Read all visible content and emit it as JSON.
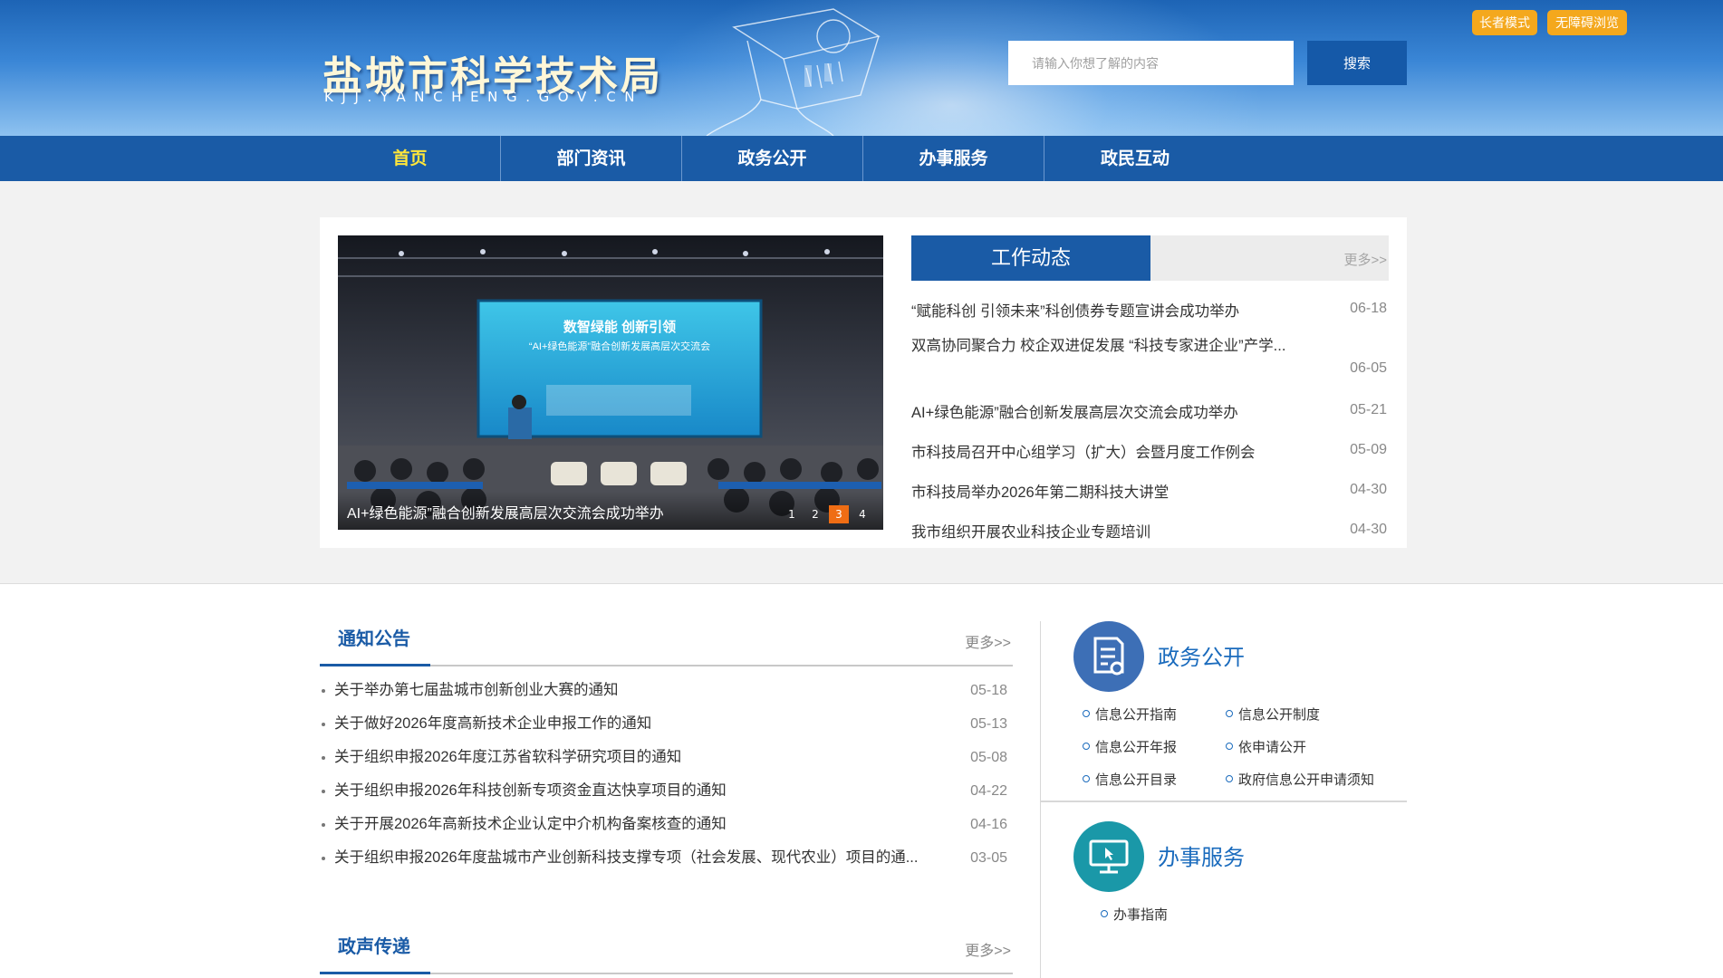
{
  "header": {
    "site_title": "盐城市科学技术局",
    "site_domain": "KJJ.YANCHENG.GOV.CN",
    "search_placeholder": "请输入你想了解的内容",
    "search_button": "搜索",
    "elder_mode": "长者模式",
    "barrier_free": "无障碍浏览"
  },
  "nav": {
    "items": [
      "首页",
      "部门资讯",
      "政务公开",
      "办事服务",
      "政民互动"
    ],
    "active_index": 0
  },
  "slider": {
    "caption": "AI+绿色能源”融合创新发展高层次交流会成功举办",
    "pages": [
      "1",
      "2",
      "3",
      "4"
    ],
    "active_page": 2,
    "screen_text_line1": "数智绿能 创新引领",
    "screen_text_line2": "“AI+绿色能源”融合创新发展高层次交流会"
  },
  "work_news": {
    "title": "工作动态",
    "more": "更多>>",
    "items": [
      {
        "title": "“赋能科创 引领未来”科创债券专题宣讲会成功举办",
        "date": "06-18"
      },
      {
        "title": "双高协同聚合力 校企双进促发展 “科技专家进企业”产学...",
        "date": "06-05"
      },
      {
        "title": "AI+绿色能源”融合创新发展高层次交流会成功举办",
        "date": "05-21"
      },
      {
        "title": "市科技局召开中心组学习（扩大）会暨月度工作例会",
        "date": "05-09"
      },
      {
        "title": "市科技局举办2026年第二期科技大讲堂",
        "date": "04-30"
      },
      {
        "title": "我市组织开展农业科技企业专题培训",
        "date": "04-30"
      }
    ]
  },
  "notices": {
    "title": "通知公告",
    "more": "更多>>",
    "items": [
      {
        "title": "关于举办第七届盐城市创新创业大赛的通知",
        "date": "05-18"
      },
      {
        "title": "关于做好2026年度高新技术企业申报工作的通知",
        "date": "05-13"
      },
      {
        "title": "关于组织申报2026年度江苏省软科学研究项目的通知",
        "date": "05-08"
      },
      {
        "title": "关于组织申报2026年科技创新专项资金直达快享项目的通知",
        "date": "04-22"
      },
      {
        "title": "关于开展2026年高新技术企业认定中介机构备案核查的通知",
        "date": "04-16"
      },
      {
        "title": "关于组织申报2026年度盐城市产业创新科技支撑专项（社会发展、现代农业）项目的通...",
        "date": "03-05"
      }
    ]
  },
  "voice": {
    "title": "政声传递",
    "more": "更多>>"
  },
  "gov_open": {
    "title": "政务公开",
    "links": [
      "信息公开指南",
      "信息公开制度",
      "信息公开年报",
      "依申请公开",
      "信息公开目录",
      "政府信息公开申请须知"
    ]
  },
  "services": {
    "title": "办事服务",
    "links": [
      "办事指南"
    ]
  },
  "colors": {
    "primary": "#1a5ba6",
    "nav_active": "#ffe63a",
    "accent_orange": "#ef6d14",
    "top_button": "#f4a81d",
    "gov_icon_bg": "#3d6fb6",
    "service_icon_bg": "#1a98a8"
  }
}
